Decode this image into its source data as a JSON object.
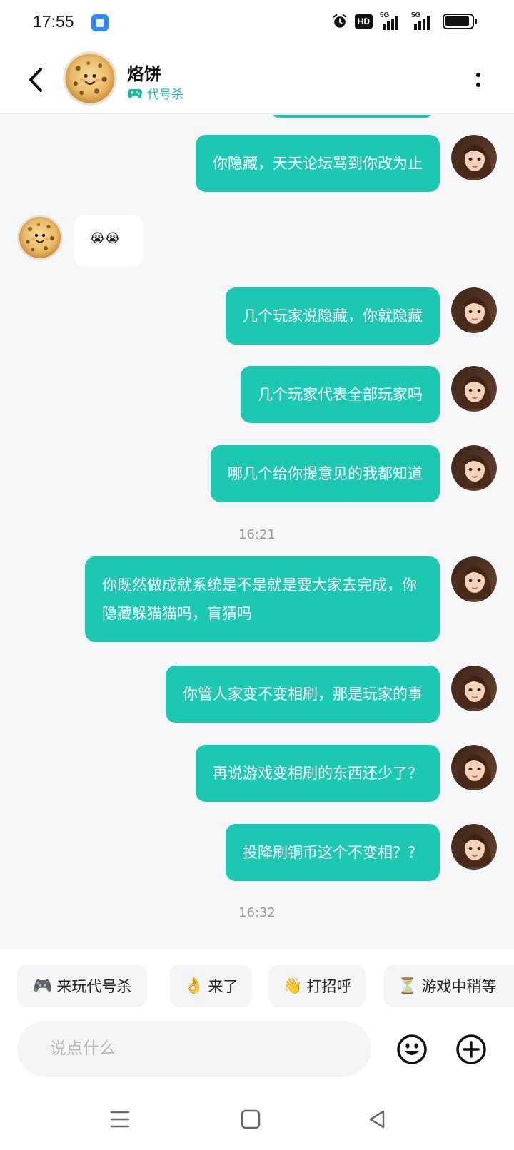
{
  "status_bar": {
    "time": "17:55",
    "hd_label": "HD",
    "signal_1": "5G",
    "signal_2": "5G"
  },
  "header": {
    "name": "烙饼",
    "tag_icon": "gamepad-icon",
    "tag_label": "代号杀",
    "accent": "#19b9a6"
  },
  "messages": [
    {
      "side": "out",
      "text": "你隐藏，天天论坛骂到你改为止"
    },
    {
      "side": "in",
      "emoji": "😭😭"
    },
    {
      "side": "out",
      "text": "几个玩家说隐藏，你就隐藏"
    },
    {
      "side": "out",
      "text": "几个玩家代表全部玩家吗"
    },
    {
      "side": "out",
      "text": "哪几个给你提意见的我都知道"
    },
    {
      "timestamp": "16:21"
    },
    {
      "side": "out",
      "text": "你既然做成就系统是不是就是要大家去完成，你隐藏躲猫猫吗，盲猜吗"
    },
    {
      "side": "out",
      "text": "你管人家变不变相刷，那是玩家的事"
    },
    {
      "side": "out",
      "text": "再说游戏变相刷的东西还少了？"
    },
    {
      "side": "out",
      "text": "投降刷铜币这个不变相？？"
    },
    {
      "timestamp": "16:32"
    }
  ],
  "quick_replies": [
    {
      "emoji": "🎮",
      "label": "来玩代号杀"
    },
    {
      "emoji": "👌",
      "label": "来了"
    },
    {
      "emoji": "👋",
      "label": "打招呼"
    },
    {
      "emoji": "⏳",
      "label": "游戏中稍等"
    }
  ],
  "input": {
    "placeholder": "说点什么",
    "value": ""
  },
  "colors": {
    "bubble_out": "#1cc8b2",
    "background": "#f5f6f8"
  },
  "nav": {
    "icons": [
      "menu-icon",
      "home-icon",
      "back-triangle-icon"
    ]
  }
}
